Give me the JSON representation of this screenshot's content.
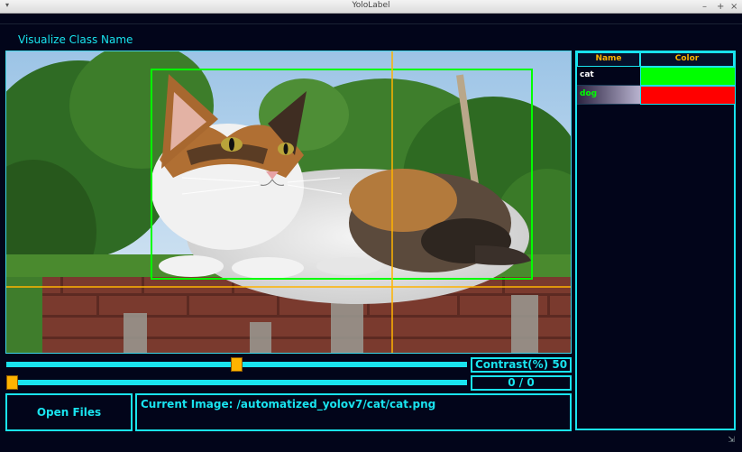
{
  "window": {
    "title": "YoloLabel"
  },
  "header": {
    "visualize_label": "Visualize Class Name"
  },
  "class_table": {
    "columns": [
      "Name",
      "Color"
    ],
    "rows": [
      {
        "name": "cat",
        "color": "#00ff00",
        "name_color": "#ffffff"
      },
      {
        "name": "dog",
        "color": "#ff0000",
        "name_color": "#00ff00"
      }
    ]
  },
  "contrast": {
    "label": "Contrast(%) 50",
    "value_percent": 50
  },
  "image_index": {
    "label": "0 / 0",
    "value_fraction": 0
  },
  "buttons": {
    "open_files": "Open Files"
  },
  "status": {
    "current_image": "Current Image: /automatized_yolov7/cat/cat.png"
  },
  "colors": {
    "accent": "#19e3ee",
    "handle": "#ffb300",
    "background": "#02051a",
    "bbox": "#00ff00",
    "crosshair": "#ffb300"
  },
  "icons": [
    "menu-arrow-icon",
    "minimize-icon",
    "maximize-icon",
    "close-icon",
    "resize-grip-icon"
  ]
}
